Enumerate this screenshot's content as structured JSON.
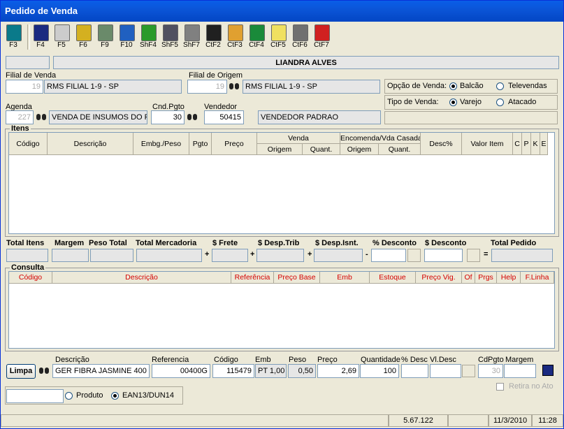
{
  "window": {
    "title": "Pedido de Venda"
  },
  "toolbar": [
    {
      "key": "F3",
      "icon": "exit-door-icon",
      "color": "#0a7a8a"
    },
    {
      "key": "F4",
      "icon": "save-disk-icon",
      "color": "#1a2a80"
    },
    {
      "key": "F5",
      "icon": "notepad-icon",
      "color": "#cccccc"
    },
    {
      "key": "F6",
      "icon": "stack-boxes-icon",
      "color": "#d4b020"
    },
    {
      "key": "F9",
      "icon": "recycle-bin-icon",
      "color": "#6a8a6a"
    },
    {
      "key": "F10",
      "icon": "puzzle-icon",
      "color": "#2060c0"
    },
    {
      "key": "ShF4",
      "icon": "money-bills-icon",
      "color": "#2a9a2a"
    },
    {
      "key": "ShF5",
      "icon": "warehouse-icon",
      "color": "#505060"
    },
    {
      "key": "ShF7",
      "icon": "stopwatch-icon",
      "color": "#808080"
    },
    {
      "key": "CtF2",
      "icon": "blackboard-icon",
      "color": "#202020"
    },
    {
      "key": "CtF3",
      "icon": "paint-palette-icon",
      "color": "#e0a030"
    },
    {
      "key": "CtF4",
      "icon": "chart-board-icon",
      "color": "#1a8a3a"
    },
    {
      "key": "CtF5",
      "icon": "light-bulb-icon",
      "color": "#f0e060"
    },
    {
      "key": "CtF6",
      "icon": "trash-can-icon",
      "color": "#707070"
    },
    {
      "key": "CtF7",
      "icon": "telephone-icon",
      "color": "#d02020"
    }
  ],
  "header": {
    "client_code": "",
    "client_name": "LIANDRA ALVES"
  },
  "filial_venda": {
    "label": "Filial de Venda",
    "code": "19",
    "name": "RMS FILIAL 1-9 - SP"
  },
  "filial_origem": {
    "label": "Filial de Origem",
    "code": "19",
    "name": "RMS FILIAL 1-9 - SP"
  },
  "opcao_venda": {
    "label": "Opção de Venda:",
    "options": [
      "Balcão",
      "Televendas"
    ],
    "selected": "Balcão"
  },
  "tipo_venda": {
    "label": "Tipo de Venda:",
    "options": [
      "Varejo",
      "Atacado"
    ],
    "selected": "Varejo"
  },
  "agenda": {
    "label": "Agenda",
    "code": "227",
    "name": "VENDA DE INSUMOS DO PDV"
  },
  "cnd_pgto": {
    "label": "Cnd.Pgto",
    "value": "30"
  },
  "vendedor": {
    "label": "Vendedor",
    "code": "50415",
    "name": "VENDEDOR PADRAO"
  },
  "itens": {
    "title": "Itens",
    "group_headers": [
      "Venda",
      "Encomenda/Vda Casada"
    ],
    "columns": [
      "Código",
      "Descrição",
      "Embg./Peso",
      "Pgto",
      "Preço",
      "Origem",
      "Quant.",
      "Origem",
      "Quant.",
      "Desc%",
      "Valor Item",
      "C",
      "P",
      "K",
      "E"
    ],
    "rows": []
  },
  "totals": {
    "labels": [
      "Total Itens",
      "Margem",
      "Peso Total",
      "Total Mercadoria",
      "$ Frete",
      "$ Desp.Trib",
      "$ Desp.Isnt.",
      "% Desconto",
      "$ Desconto",
      "Total Pedido"
    ],
    "operators": [
      "+",
      "+",
      "+",
      "-",
      "="
    ]
  },
  "consulta": {
    "title": "Consulta",
    "columns": [
      "Código",
      "Descrição",
      "Referência",
      "Preço Base",
      "Emb",
      "Estoque",
      "Preço Vig.",
      "Of",
      "Prgs",
      "Help",
      "F.Linha"
    ],
    "rows": []
  },
  "item_entry": {
    "limpa_label": "Limpa",
    "descricao": {
      "label": "Descrição",
      "value": "GER FIBRA JASMINE 400"
    },
    "referencia": {
      "label": "Referencia",
      "value": "00400G"
    },
    "codigo": {
      "label": "Código",
      "value": "115479"
    },
    "emb": {
      "label": "Emb",
      "value": "PT 1,00"
    },
    "peso": {
      "label": "Peso",
      "value": "0,50"
    },
    "preco": {
      "label": "Preço",
      "value": "2,69"
    },
    "quantidade": {
      "label": "Quantidade",
      "value": "100"
    },
    "pct_desc": {
      "label": "% Desc",
      "value": ""
    },
    "vl_desc": {
      "label": "Vl.Desc",
      "value": ""
    },
    "cd_pgto": {
      "label": "CdPgto",
      "value": "30"
    },
    "margem": {
      "label": "Margem",
      "value": ""
    },
    "retira_no_ato": {
      "label": "Retira no Ato",
      "checked": false
    }
  },
  "search": {
    "value": "",
    "options": [
      "Produto",
      "EAN13/DUN14"
    ],
    "selected": "EAN13/DUN14"
  },
  "statusbar": {
    "version": "5.67.122",
    "date": "11/3/2010",
    "time": "11:28"
  }
}
